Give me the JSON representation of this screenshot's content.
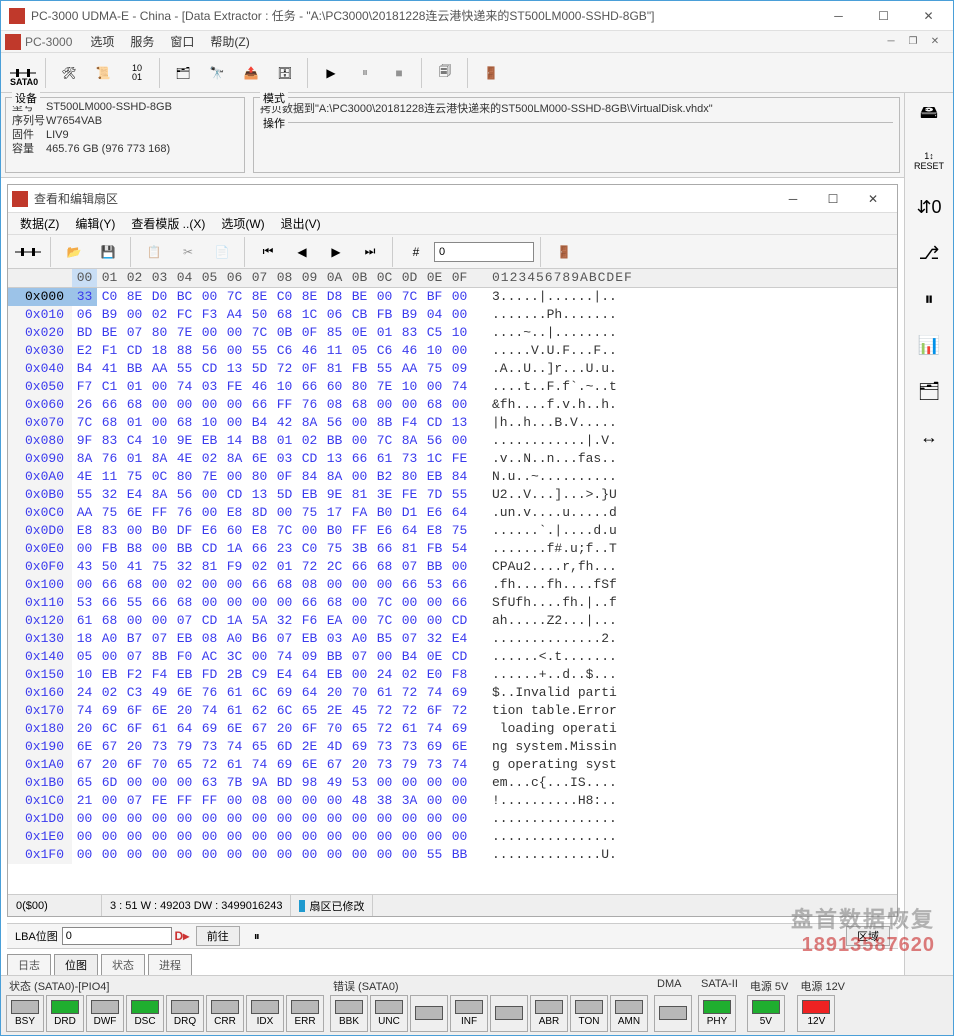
{
  "titlebar": {
    "title": "PC-3000 UDMA-E - China - [Data Extractor : 任务 - \"A:\\PC3000\\20181228连云港快递来的ST500LM000-SSHD-8GB\"]"
  },
  "menubar": {
    "brand": "PC-3000",
    "items": [
      "选项",
      "服务",
      "窗口",
      "帮助(Z)"
    ]
  },
  "toolbar": {
    "sata_label": "SATA0"
  },
  "device_box": {
    "legend": "设备",
    "model_k": "型号",
    "model_v": "ST500LM000-SSHD-8GB",
    "serial_k": "序列号",
    "serial_v": "W7654VAB",
    "fw_k": "固件",
    "fw_v": "LIV9",
    "cap_k": "容量",
    "cap_v": "465.76 GB (976 773 168)"
  },
  "mode_box": {
    "legend": "模式",
    "copy_line": "拷贝数据到\"A:\\PC3000\\20181228连云港快递来的ST500LM000-SSHD-8GB\\VirtualDisk.vhdx\"",
    "op_legend": "操作"
  },
  "hex": {
    "title": "查看和编辑扇区",
    "menu": [
      "数据(Z)",
      "编辑(Y)",
      "查看模版 ..(X)",
      "选项(W)",
      "退出(V)"
    ],
    "goto_value": "0",
    "col_header": [
      "00",
      "01",
      "02",
      "03",
      "04",
      "05",
      "06",
      "07",
      "08",
      "09",
      "0A",
      "0B",
      "0C",
      "0D",
      "0E",
      "0F"
    ],
    "ascii_header": "0123456789ABCDEF",
    "rows": [
      {
        "off": "0x000",
        "b": [
          "33",
          "C0",
          "8E",
          "D0",
          "BC",
          "00",
          "7C",
          "8E",
          "C0",
          "8E",
          "D8",
          "BE",
          "00",
          "7C",
          "BF",
          "00"
        ],
        "a": "3.....|......|.."
      },
      {
        "off": "0x010",
        "b": [
          "06",
          "B9",
          "00",
          "02",
          "FC",
          "F3",
          "A4",
          "50",
          "68",
          "1C",
          "06",
          "CB",
          "FB",
          "B9",
          "04",
          "00"
        ],
        "a": ".......Ph......."
      },
      {
        "off": "0x020",
        "b": [
          "BD",
          "BE",
          "07",
          "80",
          "7E",
          "00",
          "00",
          "7C",
          "0B",
          "0F",
          "85",
          "0E",
          "01",
          "83",
          "C5",
          "10"
        ],
        "a": "....~..|........"
      },
      {
        "off": "0x030",
        "b": [
          "E2",
          "F1",
          "CD",
          "18",
          "88",
          "56",
          "00",
          "55",
          "C6",
          "46",
          "11",
          "05",
          "C6",
          "46",
          "10",
          "00"
        ],
        "a": ".....V.U.F...F.."
      },
      {
        "off": "0x040",
        "b": [
          "B4",
          "41",
          "BB",
          "AA",
          "55",
          "CD",
          "13",
          "5D",
          "72",
          "0F",
          "81",
          "FB",
          "55",
          "AA",
          "75",
          "09"
        ],
        "a": ".A..U..]r...U.u."
      },
      {
        "off": "0x050",
        "b": [
          "F7",
          "C1",
          "01",
          "00",
          "74",
          "03",
          "FE",
          "46",
          "10",
          "66",
          "60",
          "80",
          "7E",
          "10",
          "00",
          "74"
        ],
        "a": "....t..F.f`.~..t"
      },
      {
        "off": "0x060",
        "b": [
          "26",
          "66",
          "68",
          "00",
          "00",
          "00",
          "00",
          "66",
          "FF",
          "76",
          "08",
          "68",
          "00",
          "00",
          "68",
          "00"
        ],
        "a": "&fh....f.v.h..h."
      },
      {
        "off": "0x070",
        "b": [
          "7C",
          "68",
          "01",
          "00",
          "68",
          "10",
          "00",
          "B4",
          "42",
          "8A",
          "56",
          "00",
          "8B",
          "F4",
          "CD",
          "13"
        ],
        "a": "|h..h...B.V....."
      },
      {
        "off": "0x080",
        "b": [
          "9F",
          "83",
          "C4",
          "10",
          "9E",
          "EB",
          "14",
          "B8",
          "01",
          "02",
          "BB",
          "00",
          "7C",
          "8A",
          "56",
          "00"
        ],
        "a": "............|.V."
      },
      {
        "off": "0x090",
        "b": [
          "8A",
          "76",
          "01",
          "8A",
          "4E",
          "02",
          "8A",
          "6E",
          "03",
          "CD",
          "13",
          "66",
          "61",
          "73",
          "1C",
          "FE"
        ],
        "a": ".v..N..n...fas.."
      },
      {
        "off": "0x0A0",
        "b": [
          "4E",
          "11",
          "75",
          "0C",
          "80",
          "7E",
          "00",
          "80",
          "0F",
          "84",
          "8A",
          "00",
          "B2",
          "80",
          "EB",
          "84"
        ],
        "a": "N.u..~.........."
      },
      {
        "off": "0x0B0",
        "b": [
          "55",
          "32",
          "E4",
          "8A",
          "56",
          "00",
          "CD",
          "13",
          "5D",
          "EB",
          "9E",
          "81",
          "3E",
          "FE",
          "7D",
          "55"
        ],
        "a": "U2..V...]...>.}U"
      },
      {
        "off": "0x0C0",
        "b": [
          "AA",
          "75",
          "6E",
          "FF",
          "76",
          "00",
          "E8",
          "8D",
          "00",
          "75",
          "17",
          "FA",
          "B0",
          "D1",
          "E6",
          "64"
        ],
        "a": ".un.v....u.....d"
      },
      {
        "off": "0x0D0",
        "b": [
          "E8",
          "83",
          "00",
          "B0",
          "DF",
          "E6",
          "60",
          "E8",
          "7C",
          "00",
          "B0",
          "FF",
          "E6",
          "64",
          "E8",
          "75"
        ],
        "a": "......`.|....d.u"
      },
      {
        "off": "0x0E0",
        "b": [
          "00",
          "FB",
          "B8",
          "00",
          "BB",
          "CD",
          "1A",
          "66",
          "23",
          "C0",
          "75",
          "3B",
          "66",
          "81",
          "FB",
          "54"
        ],
        "a": ".......f#.u;f..T"
      },
      {
        "off": "0x0F0",
        "b": [
          "43",
          "50",
          "41",
          "75",
          "32",
          "81",
          "F9",
          "02",
          "01",
          "72",
          "2C",
          "66",
          "68",
          "07",
          "BB",
          "00"
        ],
        "a": "CPAu2....r,fh..."
      },
      {
        "off": "0x100",
        "b": [
          "00",
          "66",
          "68",
          "00",
          "02",
          "00",
          "00",
          "66",
          "68",
          "08",
          "00",
          "00",
          "00",
          "66",
          "53",
          "66"
        ],
        "a": ".fh....fh....fSf"
      },
      {
        "off": "0x110",
        "b": [
          "53",
          "66",
          "55",
          "66",
          "68",
          "00",
          "00",
          "00",
          "00",
          "66",
          "68",
          "00",
          "7C",
          "00",
          "00",
          "66"
        ],
        "a": "SfUfh....fh.|..f"
      },
      {
        "off": "0x120",
        "b": [
          "61",
          "68",
          "00",
          "00",
          "07",
          "CD",
          "1A",
          "5A",
          "32",
          "F6",
          "EA",
          "00",
          "7C",
          "00",
          "00",
          "CD"
        ],
        "a": "ah.....Z2...|..."
      },
      {
        "off": "0x130",
        "b": [
          "18",
          "A0",
          "B7",
          "07",
          "EB",
          "08",
          "A0",
          "B6",
          "07",
          "EB",
          "03",
          "A0",
          "B5",
          "07",
          "32",
          "E4"
        ],
        "a": "..............2."
      },
      {
        "off": "0x140",
        "b": [
          "05",
          "00",
          "07",
          "8B",
          "F0",
          "AC",
          "3C",
          "00",
          "74",
          "09",
          "BB",
          "07",
          "00",
          "B4",
          "0E",
          "CD"
        ],
        "a": "......<.t......."
      },
      {
        "off": "0x150",
        "b": [
          "10",
          "EB",
          "F2",
          "F4",
          "EB",
          "FD",
          "2B",
          "C9",
          "E4",
          "64",
          "EB",
          "00",
          "24",
          "02",
          "E0",
          "F8"
        ],
        "a": "......+..d..$..."
      },
      {
        "off": "0x160",
        "b": [
          "24",
          "02",
          "C3",
          "49",
          "6E",
          "76",
          "61",
          "6C",
          "69",
          "64",
          "20",
          "70",
          "61",
          "72",
          "74",
          "69"
        ],
        "a": "$..Invalid parti"
      },
      {
        "off": "0x170",
        "b": [
          "74",
          "69",
          "6F",
          "6E",
          "20",
          "74",
          "61",
          "62",
          "6C",
          "65",
          "2E",
          "45",
          "72",
          "72",
          "6F",
          "72"
        ],
        "a": "tion table.Error"
      },
      {
        "off": "0x180",
        "b": [
          "20",
          "6C",
          "6F",
          "61",
          "64",
          "69",
          "6E",
          "67",
          "20",
          "6F",
          "70",
          "65",
          "72",
          "61",
          "74",
          "69"
        ],
        "a": " loading operati"
      },
      {
        "off": "0x190",
        "b": [
          "6E",
          "67",
          "20",
          "73",
          "79",
          "73",
          "74",
          "65",
          "6D",
          "2E",
          "4D",
          "69",
          "73",
          "73",
          "69",
          "6E"
        ],
        "a": "ng system.Missin"
      },
      {
        "off": "0x1A0",
        "b": [
          "67",
          "20",
          "6F",
          "70",
          "65",
          "72",
          "61",
          "74",
          "69",
          "6E",
          "67",
          "20",
          "73",
          "79",
          "73",
          "74"
        ],
        "a": "g operating syst"
      },
      {
        "off": "0x1B0",
        "b": [
          "65",
          "6D",
          "00",
          "00",
          "00",
          "63",
          "7B",
          "9A",
          "BD",
          "98",
          "49",
          "53",
          "00",
          "00",
          "00",
          "00"
        ],
        "a": "em...c{...IS...."
      },
      {
        "off": "0x1C0",
        "b": [
          "21",
          "00",
          "07",
          "FE",
          "FF",
          "FF",
          "00",
          "08",
          "00",
          "00",
          "00",
          "48",
          "38",
          "3A",
          "00",
          "00"
        ],
        "a": "!..........H8:.."
      },
      {
        "off": "0x1D0",
        "b": [
          "00",
          "00",
          "00",
          "00",
          "00",
          "00",
          "00",
          "00",
          "00",
          "00",
          "00",
          "00",
          "00",
          "00",
          "00",
          "00"
        ],
        "a": "................"
      },
      {
        "off": "0x1E0",
        "b": [
          "00",
          "00",
          "00",
          "00",
          "00",
          "00",
          "00",
          "00",
          "00",
          "00",
          "00",
          "00",
          "00",
          "00",
          "00",
          "00"
        ],
        "a": "................"
      },
      {
        "off": "0x1F0",
        "b": [
          "00",
          "00",
          "00",
          "00",
          "00",
          "00",
          "00",
          "00",
          "00",
          "00",
          "00",
          "00",
          "00",
          "00",
          "55",
          "BB"
        ],
        "a": "..............U."
      }
    ],
    "status_left": "0($00)",
    "status_mid": "3 : 51 W : 49203 DW : 3499016243",
    "status_mod": "扇区已修改"
  },
  "lba": {
    "label": "LBA位图",
    "value": "0",
    "go": "前往",
    "refresh": "区域"
  },
  "tabs": [
    "日志",
    "位图",
    "状态",
    "进程"
  ],
  "footer": {
    "status_label": "状态 (SATA0)-[PIO4]",
    "status": [
      {
        "n": "BSY",
        "c": "grey"
      },
      {
        "n": "DRD",
        "c": "green"
      },
      {
        "n": "DWF",
        "c": "grey"
      },
      {
        "n": "DSC",
        "c": "green"
      },
      {
        "n": "DRQ",
        "c": "grey"
      },
      {
        "n": "CRR",
        "c": "grey"
      },
      {
        "n": "IDX",
        "c": "grey"
      },
      {
        "n": "ERR",
        "c": "grey"
      }
    ],
    "err_label": "错误 (SATA0)",
    "err": [
      {
        "n": "BBK",
        "c": "grey"
      },
      {
        "n": "UNC",
        "c": "grey"
      },
      {
        "n": "",
        "c": "grey"
      },
      {
        "n": "INF",
        "c": "grey"
      },
      {
        "n": "",
        "c": "grey"
      },
      {
        "n": "ABR",
        "c": "grey"
      },
      {
        "n": "TON",
        "c": "grey"
      },
      {
        "n": "AMN",
        "c": "grey"
      }
    ],
    "dma_label": "DMA",
    "dma": [
      {
        "n": "",
        "c": "grey"
      }
    ],
    "sata2_label": "SATA-II",
    "sata2": [
      {
        "n": "PHY",
        "c": "green"
      }
    ],
    "p5_label": "电源 5V",
    "p5": [
      {
        "n": "5V",
        "c": "green"
      }
    ],
    "p12_label": "电源 12V",
    "p12": [
      {
        "n": "12V",
        "c": "red"
      }
    ]
  },
  "watermark": {
    "l1": "盘首数据恢复",
    "l2": "18913587620"
  }
}
